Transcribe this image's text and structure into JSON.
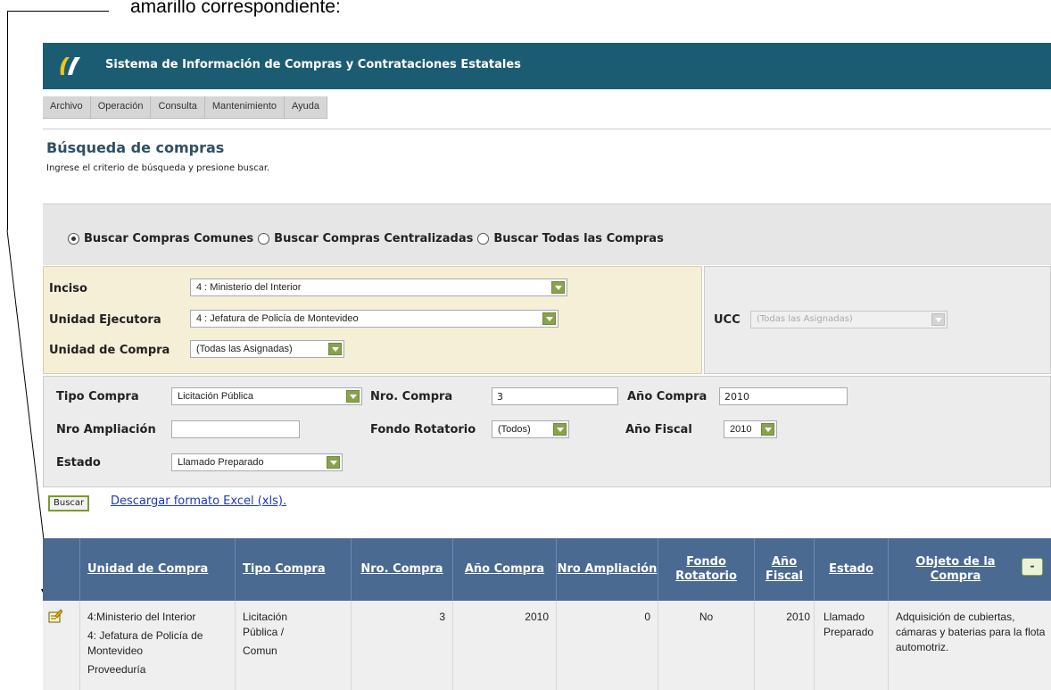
{
  "doc_note": "amarillo correspondiente:",
  "app": {
    "title": "Sistema de Información de Compras y Contrataciones Estatales",
    "brand_color": "#1c5c73",
    "logo_icon": "siice-logo-icon"
  },
  "menu": [
    "Archivo",
    "Operación",
    "Consulta",
    "Mantenimiento",
    "Ayuda"
  ],
  "page": {
    "title": "Búsqueda de compras",
    "subtitle": "Ingrese el criterio de búsqueda y presione buscar."
  },
  "search_scope": {
    "options": [
      "Buscar Compras Comunes",
      "Buscar Compras Centralizadas",
      "Buscar Todas las Compras"
    ],
    "selected": "Buscar Compras Comunes"
  },
  "org": {
    "inciso_label": "Inciso",
    "inciso_value": "4 : Ministerio del Interior",
    "unidad_ejecutora_label": "Unidad Ejecutora",
    "unidad_ejecutora_value": "4 : Jefatura de Policía de Montevideo",
    "unidad_compra_label": "Unidad de Compra",
    "unidad_compra_value": "(Todas las Asignadas)",
    "ucc_label": "UCC",
    "ucc_value": "(Todas las Asignadas)"
  },
  "filters": {
    "tipo_compra_label": "Tipo Compra",
    "tipo_compra_value": "Licitación Pública",
    "nro_compra_label": "Nro. Compra",
    "nro_compra_value": "3",
    "anio_compra_label": "Año Compra",
    "anio_compra_value": "2010",
    "nro_ampliacion_label": "Nro Ampliación",
    "nro_ampliacion_value": "",
    "fondo_rotatorio_label": "Fondo Rotatorio",
    "fondo_rotatorio_value": "(Todos)",
    "anio_fiscal_label": "Año Fiscal",
    "anio_fiscal_value": "2010",
    "estado_label": "Estado",
    "estado_value": "Llamado Preparado"
  },
  "actions": {
    "buscar_label": "Buscar",
    "excel_link": "Descargar formato Excel (xls)."
  },
  "table": {
    "headers": [
      "Unidad de Compra",
      "Tipo Compra",
      "Nro. Compra",
      "Año Compra",
      "Nro Ampliación",
      "Fondo Rotatorio",
      "Año Fiscal",
      "Estado",
      "Objeto de la Compra"
    ],
    "collapse_label": "-",
    "header_color": "#4a6a92",
    "rows": [
      {
        "edit_icon": "edit-purchase-icon",
        "unidad_compra": [
          "4:Ministerio del Interior",
          "4: Jefatura de Policía de Montevideo",
          "Proveeduría"
        ],
        "tipo_compra": [
          "Licitación Pública /",
          "Comun"
        ],
        "nro_compra": "3",
        "anio_compra": "2010",
        "nro_ampliacion": "0",
        "fondo_rotatorio": "No",
        "anio_fiscal": "2010",
        "estado": "Llamado Preparado",
        "objeto": "Adquisición de cubiertas, cámaras y baterias para la flota automotriz."
      }
    ]
  }
}
